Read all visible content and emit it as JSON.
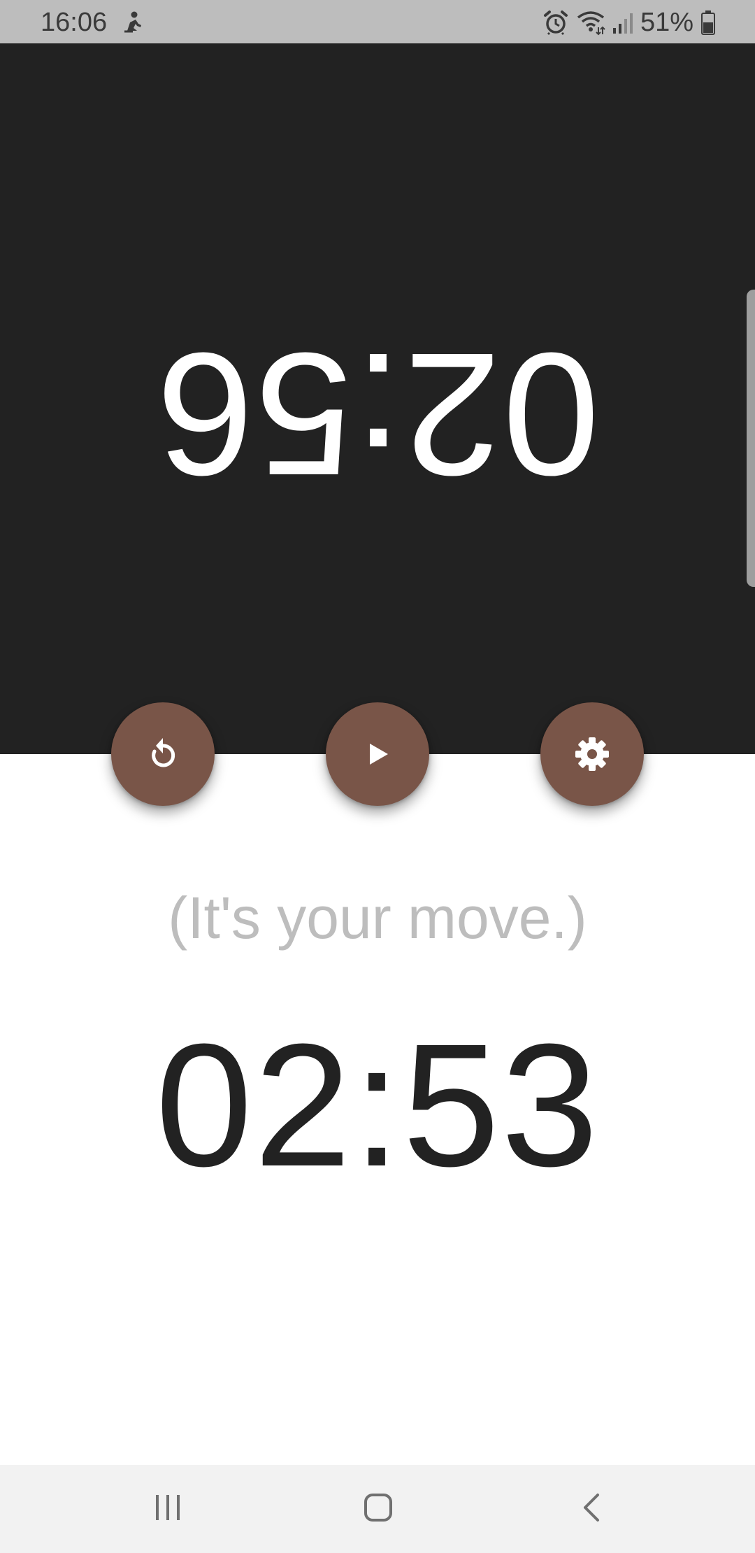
{
  "status_bar": {
    "time": "16:06",
    "battery_percent": "51%",
    "icons": [
      "person-icon",
      "alarm-icon",
      "wifi-icon",
      "signal-icon",
      "battery-icon"
    ]
  },
  "opponent_clock": {
    "time": "02:56",
    "orientation": "upside-down"
  },
  "controls": {
    "icons": [
      "reset-icon",
      "play-icon",
      "settings-icon"
    ],
    "accent_color": "#795548"
  },
  "player_clock": {
    "hint": "(It's your move.)",
    "time": "02:53"
  },
  "nav_bar": {
    "icons": [
      "recents-icon",
      "home-icon",
      "back-icon"
    ]
  },
  "colors": {
    "top_panel": "#222222",
    "bottom_panel": "#ffffff",
    "hint_text": "#bdbdbd"
  }
}
